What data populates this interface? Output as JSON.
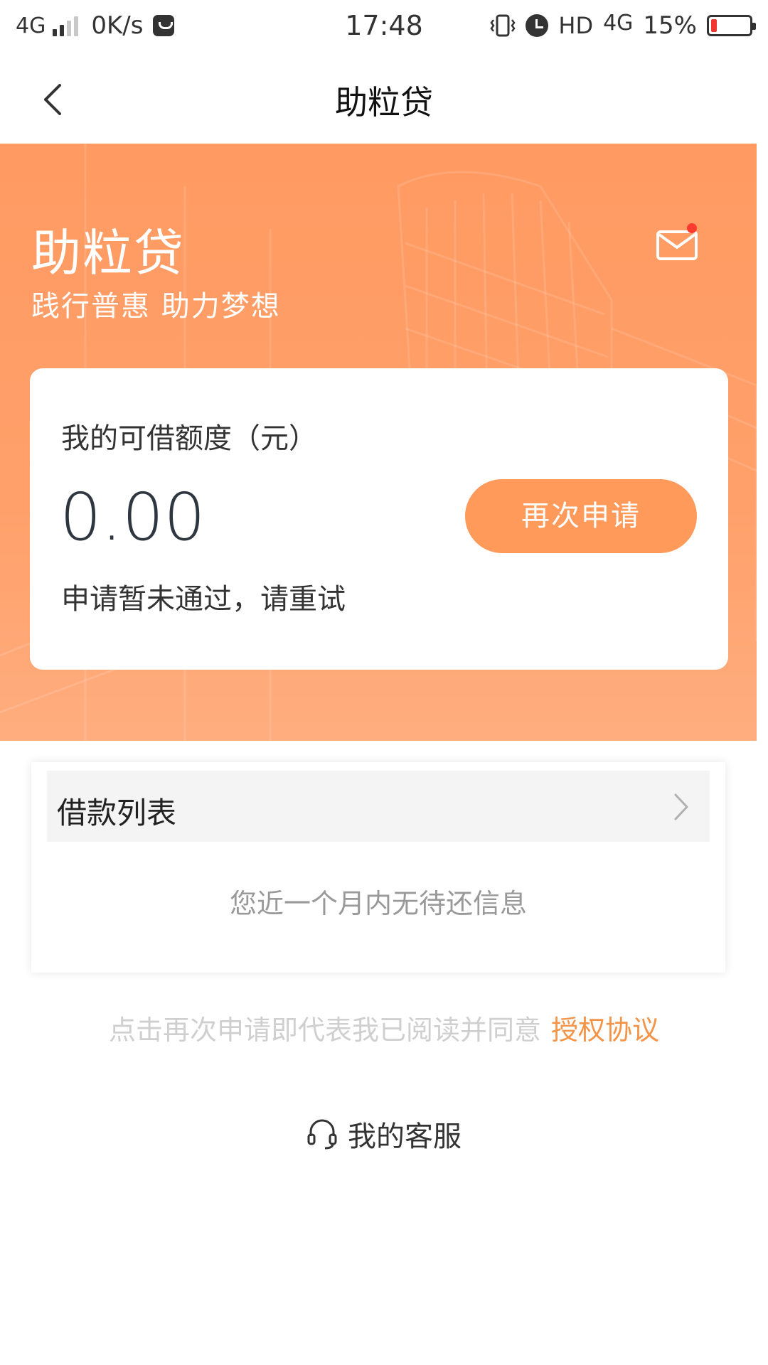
{
  "status_bar": {
    "network": "4G",
    "speed": "0K/s",
    "time": "17:48",
    "hd": "HD",
    "network2": "4G",
    "battery_pct": "15%",
    "battery_level": 0.15,
    "icons": [
      "signal-icon",
      "shop-icon",
      "vibrate-icon",
      "alarm-icon",
      "battery-icon"
    ]
  },
  "nav": {
    "title": "助粒贷",
    "back_icon": "chevron-left-icon"
  },
  "banner": {
    "brand": "助粒贷",
    "slogan": "践行普惠 助力梦想",
    "mail_icon": "mail-icon",
    "accent_color": "#ff9a62"
  },
  "credit": {
    "label": "我的可借额度（元）",
    "amount": "0.00",
    "button": "再次申请",
    "status": "申请暂未通过，请重试"
  },
  "loan_list": {
    "title": "借款列表",
    "empty": "您近一个月内无待还信息"
  },
  "agreement": {
    "text": "点击再次申请即代表我已阅读并同意",
    "link": "授权协议",
    "link_color": "#f39449"
  },
  "service": {
    "label": "我的客服",
    "icon": "headset-icon"
  }
}
